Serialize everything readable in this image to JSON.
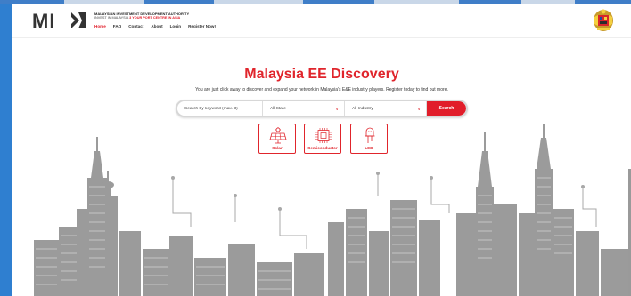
{
  "header": {
    "logo_text": "MI",
    "org_name": "MALAYSIAN INVESTMENT DEVELOPMENT AUTHORITY",
    "tagline_prefix": "INVEST IN MALAYSIA",
    "tagline_emphasis": "3 YOUR PORT CENTRE IN ASIA",
    "nav": [
      {
        "label": "Home",
        "active": true
      },
      {
        "label": "FAQ",
        "active": false
      },
      {
        "label": "Contact",
        "active": false
      },
      {
        "label": "About",
        "active": false
      },
      {
        "label": "Login",
        "active": false
      },
      {
        "label": "Register Now!",
        "active": false
      }
    ]
  },
  "hero": {
    "title": "Malaysia EE Discovery",
    "subtitle": "You are just click away to discover and expand your network in Malaysia's E&E industry players. Register today to find out more."
  },
  "search": {
    "keyword_placeholder": "Search by keyword (max. 3)",
    "state_value": "All State",
    "industry_value": "All Industry",
    "button_label": "Search"
  },
  "categories": [
    {
      "label": "Solar",
      "icon": "solar-panel-icon"
    },
    {
      "label": "Semiconductor",
      "icon": "chip-icon"
    },
    {
      "label": "LED",
      "icon": "led-bulb-icon"
    }
  ],
  "colors": {
    "accent": "#e0252c",
    "browser_blue": "#2f7fd0",
    "skyline_gray": "#8c8c8c"
  }
}
